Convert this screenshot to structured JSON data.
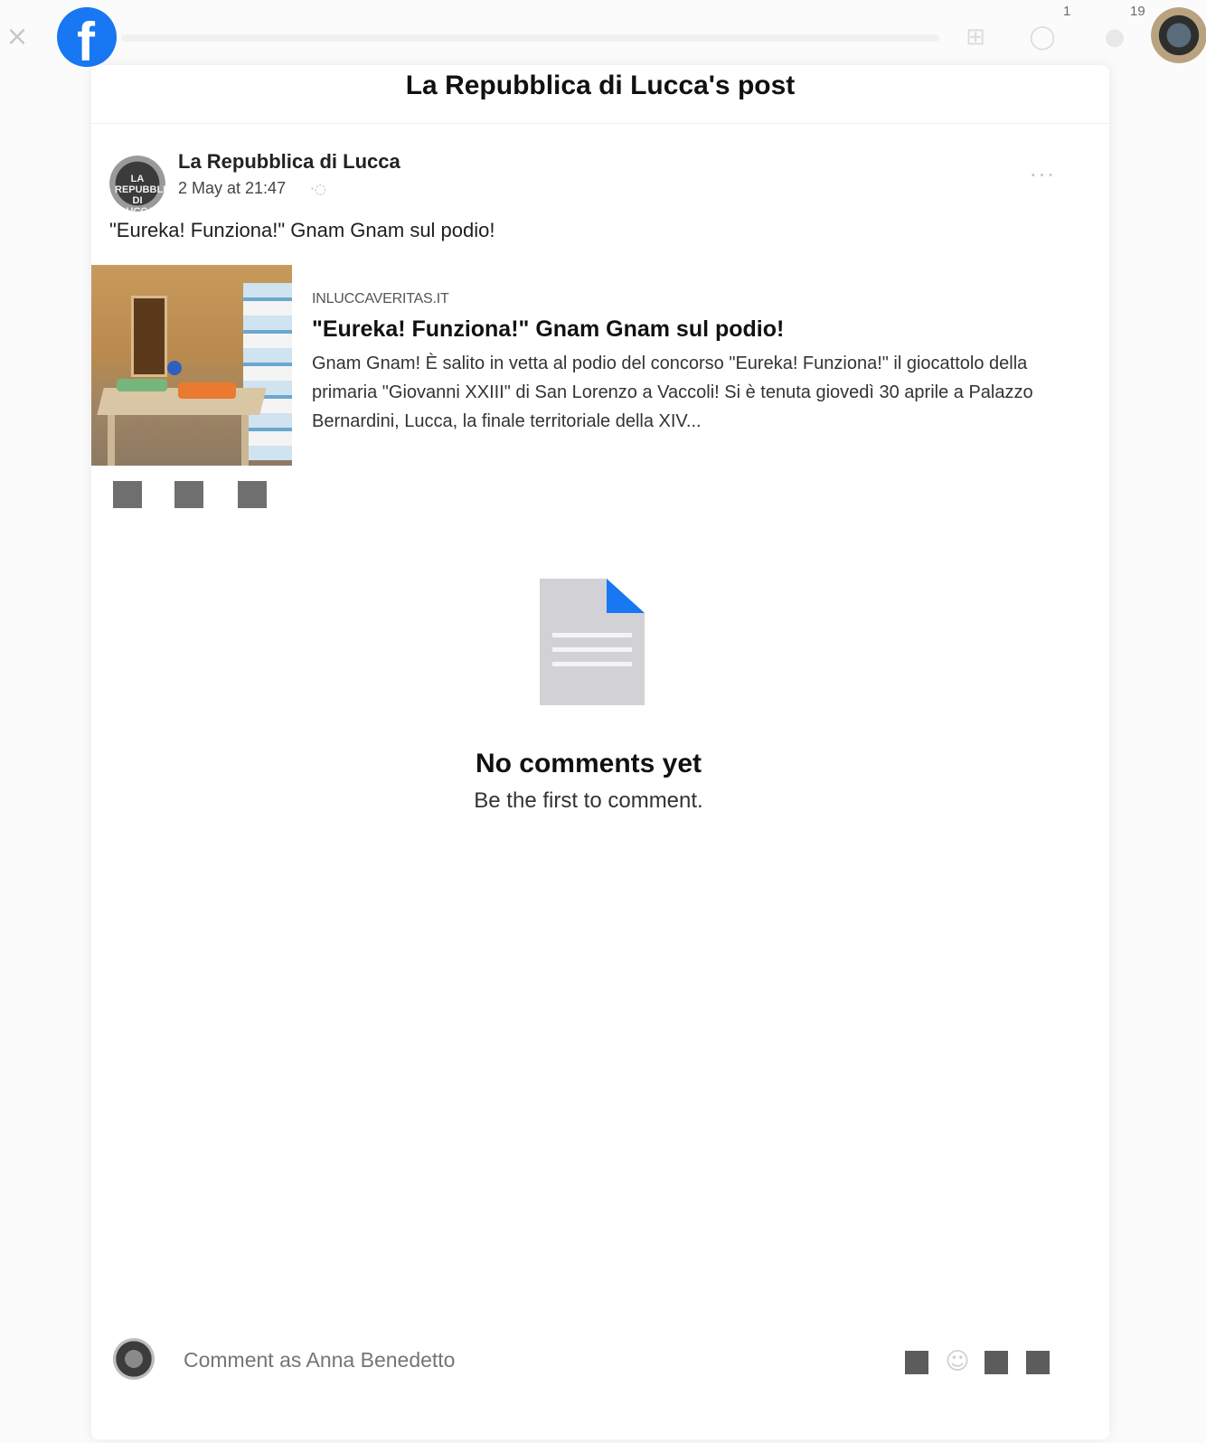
{
  "topbar": {
    "close_icon": "×",
    "logo_letter": "f",
    "menu_icon": "⊞",
    "messenger_icon": "◯",
    "messenger_badge": "1",
    "notifications_icon": "●",
    "notifications_badge": "19",
    "brand_color": "#1877f2"
  },
  "dialog": {
    "title": "La Repubblica di Lucca's post"
  },
  "post": {
    "page_avatar_text": "LA REPUBBLICA DI LUCCA",
    "author": "La Repubblica di Lucca",
    "time": "2 May at 21:47",
    "globe_icon": "·◌",
    "more_icon": "···",
    "text": "\"Eureka! Funziona!\" Gnam Gnam sul podio!"
  },
  "link_preview": {
    "domain": "INLUCCAVERITAS.IT",
    "title": "\"Eureka! Funziona!\" Gnam Gnam sul podio!",
    "description": "Gnam Gnam! È salito in vetta al podio del concorso \"Eureka! Funziona!\" il giocattolo della primaria \"Giovanni XXIII\" di San Lorenzo a Vaccoli! Si è tenuta giovedì 30 aprile a Palazzo Bernardini, Lucca, la finale territoriale della XIV..."
  },
  "empty_state": {
    "title": "No comments yet",
    "subtitle": "Be the first to comment."
  },
  "composer": {
    "placeholder": "Comment as Anna Benedetto",
    "emoji_icon": "☺"
  }
}
